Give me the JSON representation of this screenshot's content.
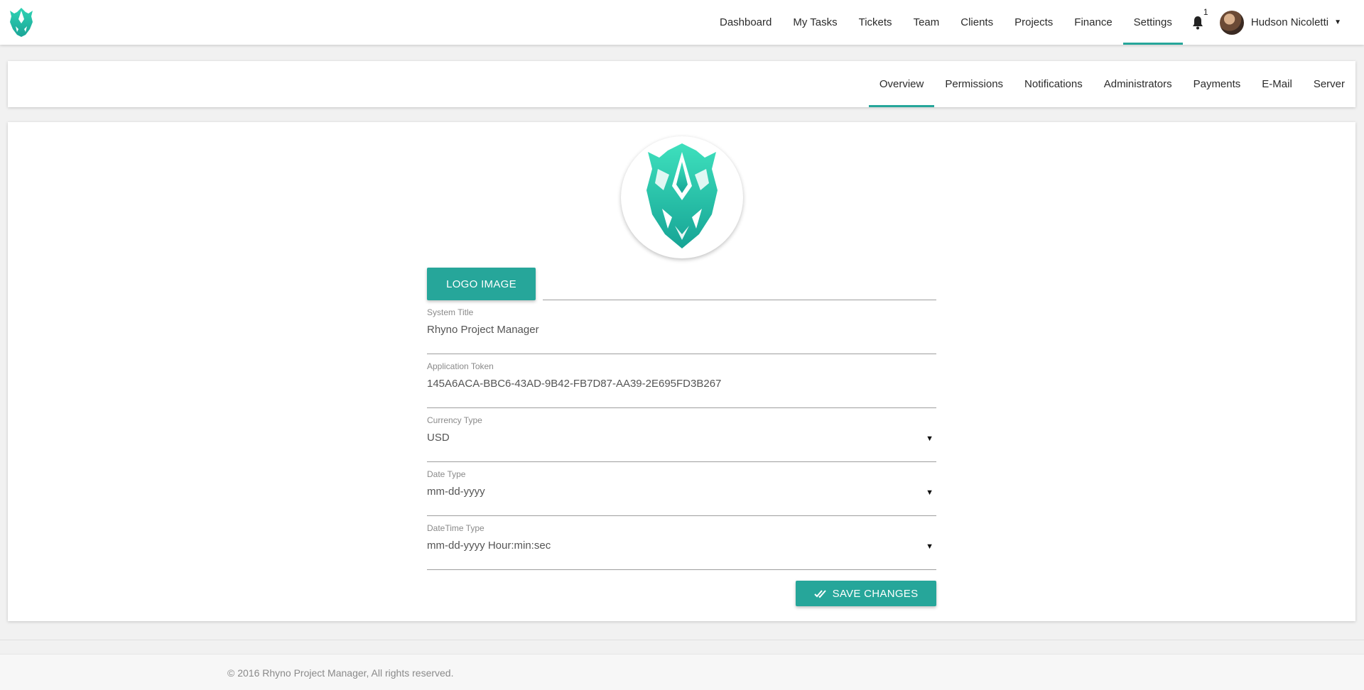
{
  "colors": {
    "accent": "#26a69a"
  },
  "topbar": {
    "logo_icon": "rhino-logo-icon",
    "nav": [
      "Dashboard",
      "My Tasks",
      "Tickets",
      "Team",
      "Clients",
      "Projects",
      "Finance",
      "Settings"
    ],
    "active_nav": "Settings",
    "notifications": {
      "icon": "bell-icon",
      "count": "1"
    },
    "user": {
      "name": "Hudson Nicoletti",
      "caret": "▼"
    }
  },
  "subnav": {
    "tabs": [
      "Overview",
      "Permissions",
      "Notifications",
      "Administrators",
      "Payments",
      "E-Mail",
      "Server"
    ],
    "active_tab": "Overview"
  },
  "form": {
    "logo_button": "LOGO IMAGE",
    "logo_path": "",
    "system_title": {
      "label": "System Title",
      "value": "Rhyno Project Manager"
    },
    "app_token": {
      "label": "Application Token",
      "value": "145A6ACA-BBC6-43AD-9B42-FB7D87-AA39-2E695FD3B267"
    },
    "currency": {
      "label": "Currency Type",
      "value": "USD",
      "caret": "▼"
    },
    "date_type": {
      "label": "Date Type",
      "value": "mm-dd-yyyy",
      "caret": "▼"
    },
    "datetime_type": {
      "label": "DateTime Type",
      "value": "mm-dd-yyyy Hour:min:sec",
      "caret": "▼"
    },
    "save_button": "SAVE CHANGES"
  },
  "footer": {
    "text": "© 2016 Rhyno Project Manager, All rights reserved."
  }
}
